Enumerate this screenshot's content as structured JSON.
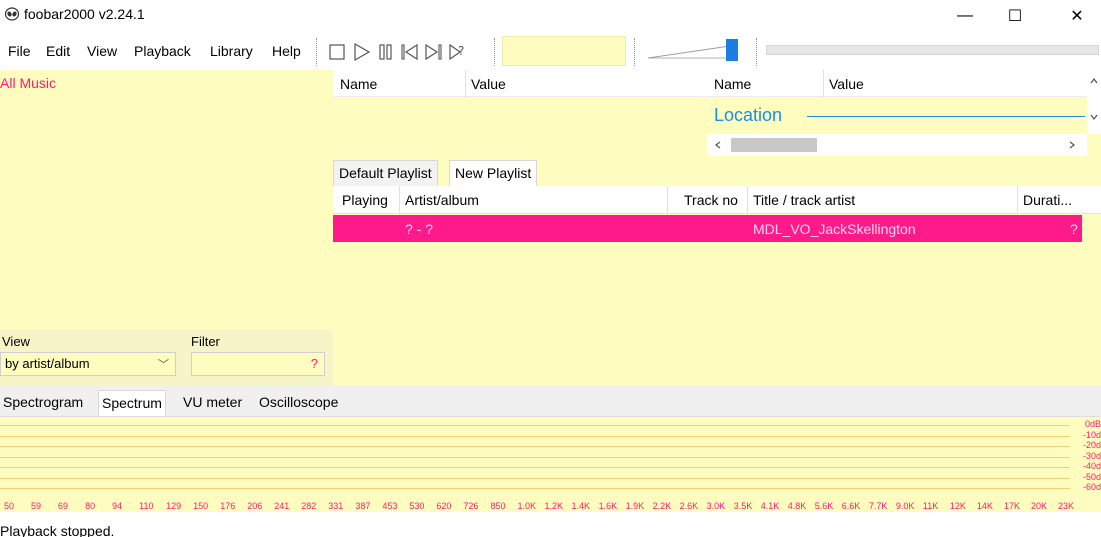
{
  "window": {
    "title": "foobar2000 v2.24.1",
    "controls": {
      "minimize": "—",
      "maximize": "☐",
      "close": "✕"
    }
  },
  "menu": {
    "items": [
      "File",
      "Edit",
      "View",
      "Playback",
      "Library",
      "Help"
    ]
  },
  "toolbar": {
    "icons": [
      "stop-icon",
      "play-icon",
      "pause-icon",
      "previous-icon",
      "next-icon",
      "random-icon"
    ],
    "volume_level": 0.9,
    "seek_progress": 0
  },
  "left_panel": {
    "root_item": "All Music",
    "view_label": "View",
    "view_value": "by artist/album",
    "filter_label": "Filter",
    "filter_indicator": "?"
  },
  "properties": {
    "panel1": {
      "col_name": "Name",
      "col_value": "Value"
    },
    "panel2": {
      "col_name": "Name",
      "col_value": "Value",
      "group": "Location"
    }
  },
  "playlist_tabs": [
    "Default Playlist",
    "New Playlist"
  ],
  "playlist": {
    "columns": [
      "Playing",
      "Artist/album",
      "Track no",
      "Title / track artist",
      "Durati..."
    ],
    "rows": [
      {
        "playing": "",
        "artist_album": "? - ?",
        "track_no": "",
        "title": "MDL_VO_JackSkellington",
        "duration": "?"
      }
    ]
  },
  "vis_tabs": [
    "Spectrogram",
    "Spectrum",
    "VU meter",
    "Oscilloscope"
  ],
  "spectrum": {
    "db_labels": [
      "0dB",
      "-10d",
      "-20d",
      "-30d",
      "-40d",
      "-50d",
      "-60d"
    ],
    "freq_labels": [
      "50",
      "59",
      "69",
      "80",
      "94",
      "110",
      "129",
      "150",
      "176",
      "206",
      "241",
      "282",
      "331",
      "387",
      "453",
      "530",
      "620",
      "726",
      "850",
      "1.0K",
      "1.2K",
      "1.4K",
      "1.6K",
      "1.9K",
      "2.2K",
      "2.6K",
      "3.0K",
      "3.5K",
      "4.1K",
      "4.8K",
      "5.6K",
      "6.6K",
      "7.7K",
      "9.0K",
      "11K",
      "12K",
      "14K",
      "17K",
      "20K",
      "23K"
    ]
  },
  "status": {
    "text": "Playback stopped."
  },
  "colors": {
    "panel_bg": "#fffcc0",
    "accent": "#ff1a8c",
    "location": "#1a8fe0",
    "spectrum_text": "#ff1a6b"
  }
}
